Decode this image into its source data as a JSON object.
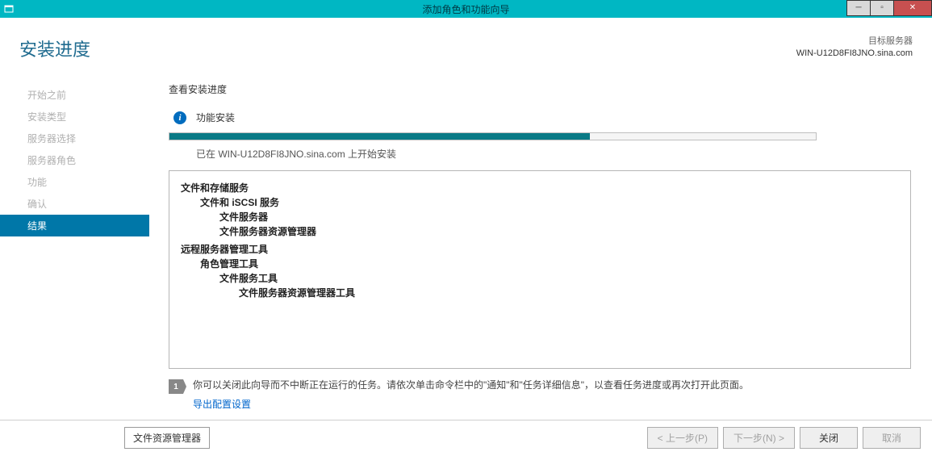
{
  "window": {
    "title": "添加角色和功能向导"
  },
  "header": {
    "page_title": "安装进度",
    "target_label": "目标服务器",
    "target_server": "WIN-U12D8FI8JNO.sina.com"
  },
  "sidebar": {
    "items": [
      {
        "label": "开始之前"
      },
      {
        "label": "安装类型"
      },
      {
        "label": "服务器选择"
      },
      {
        "label": "服务器角色"
      },
      {
        "label": "功能"
      },
      {
        "label": "确认"
      },
      {
        "label": "结果"
      }
    ]
  },
  "content": {
    "subheading": "查看安装进度",
    "status_text": "功能安装",
    "progress_percent": 65,
    "progress_subtext": "已在 WIN-U12D8FI8JNO.sina.com 上开始安装",
    "features_group1": {
      "l0": "文件和存储服务",
      "l1": "文件和 iSCSI 服务",
      "l2a": "文件服务器",
      "l2b": "文件服务器资源管理器"
    },
    "features_group2": {
      "l0": "远程服务器管理工具",
      "l1": "角色管理工具",
      "l2": "文件服务工具",
      "l3": "文件服务器资源管理器工具"
    },
    "flag_note": "你可以关闭此向导而不中断正在运行的任务。请依次单击命令栏中的\"通知\"和\"任务详细信息\"，以查看任务进度或再次打开此页面。",
    "export_link": "导出配置设置",
    "flag_badge": "1"
  },
  "bottom": {
    "left_chip": "文件资源管理器",
    "prev": "< 上一步(P)",
    "next": "下一步(N) >",
    "close": "关闭",
    "cancel": "取消"
  }
}
